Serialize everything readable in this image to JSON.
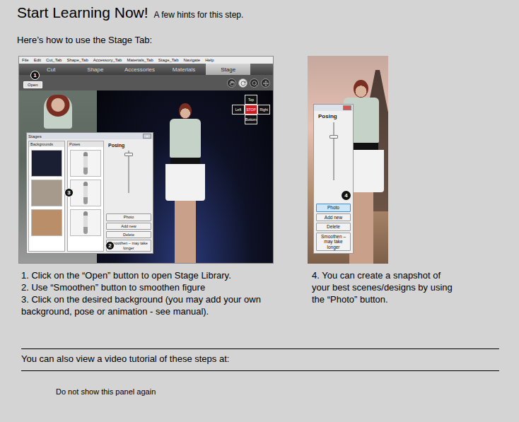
{
  "header": {
    "title": "Start Learning Now!",
    "subtitle": "A few hints for this step."
  },
  "intro": "Here’s how to use the Stage Tab:",
  "app_screenshot": {
    "menu": [
      "File",
      "Edit",
      "Cut_Tab",
      "Shape_Tab",
      "Accessory_Tab",
      "Materials_Tab",
      "Stage_Tab",
      "Navigate",
      "Help"
    ],
    "tabs": [
      {
        "label": "Cut",
        "selected": false
      },
      {
        "label": "Shape",
        "selected": false
      },
      {
        "label": "Accessories",
        "selected": false
      },
      {
        "label": "Materials",
        "selected": false
      },
      {
        "label": "Stage",
        "selected": true
      }
    ],
    "toolbar": {
      "open_button": "Open",
      "tools": [
        {
          "kind": "pan",
          "selected": false
        },
        {
          "kind": "rotate",
          "selected": true
        },
        {
          "kind": "zoom",
          "selected": false
        },
        {
          "kind": "move",
          "selected": false
        }
      ]
    },
    "navigator": {
      "top": "Top",
      "left": "Left",
      "stop": "STOP",
      "right": "Right",
      "bottom": "Bottom"
    },
    "stages_dialog": {
      "title": "Stages",
      "close": "×",
      "columns": {
        "backgrounds": "Backgrounds",
        "poses": "Poses"
      },
      "backgrounds": [
        {
          "color": "#1b1f33",
          "selected": false
        },
        {
          "color": "#a69a8c",
          "selected": false
        },
        {
          "color": "#b98e68",
          "selected": false
        }
      ],
      "poses": [
        {
          "selected": false
        },
        {
          "selected": false
        },
        {
          "selected": false
        }
      ],
      "posing": {
        "label": "Posing",
        "level": 0.9
      },
      "buttons": [
        {
          "label": "Photo",
          "highlighted": false
        },
        {
          "label": "Add new",
          "highlighted": false
        },
        {
          "label": "Delete",
          "highlighted": false
        },
        {
          "label": "Smoothen – may take longer",
          "highlighted": false
        }
      ]
    },
    "markers": [
      "1",
      "2",
      "3"
    ]
  },
  "photo_screenshot": {
    "posing": {
      "label": "Posing",
      "level": 0.75
    },
    "buttons": [
      {
        "label": "Photo",
        "highlighted": true
      },
      {
        "label": "Add new",
        "highlighted": false
      },
      {
        "label": "Delete",
        "highlighted": false
      },
      {
        "label": "Smoothen – may take longer",
        "highlighted": false
      }
    ],
    "marker": "4"
  },
  "steps": [
    "1. Click on the “Open” button to open Stage Library.",
    "2. Use “Smoothen” button to smoothen figure",
    "3. Click on the desired background (you may add your own background, pose or animation - see manual)."
  ],
  "photo_step": "4. You can create a snapshot of your best scenes/designs by using the “Photo” button.",
  "video": {
    "text": "You can also view a video tutorial of these steps at:"
  },
  "dont_show": "Do not show this panel again"
}
